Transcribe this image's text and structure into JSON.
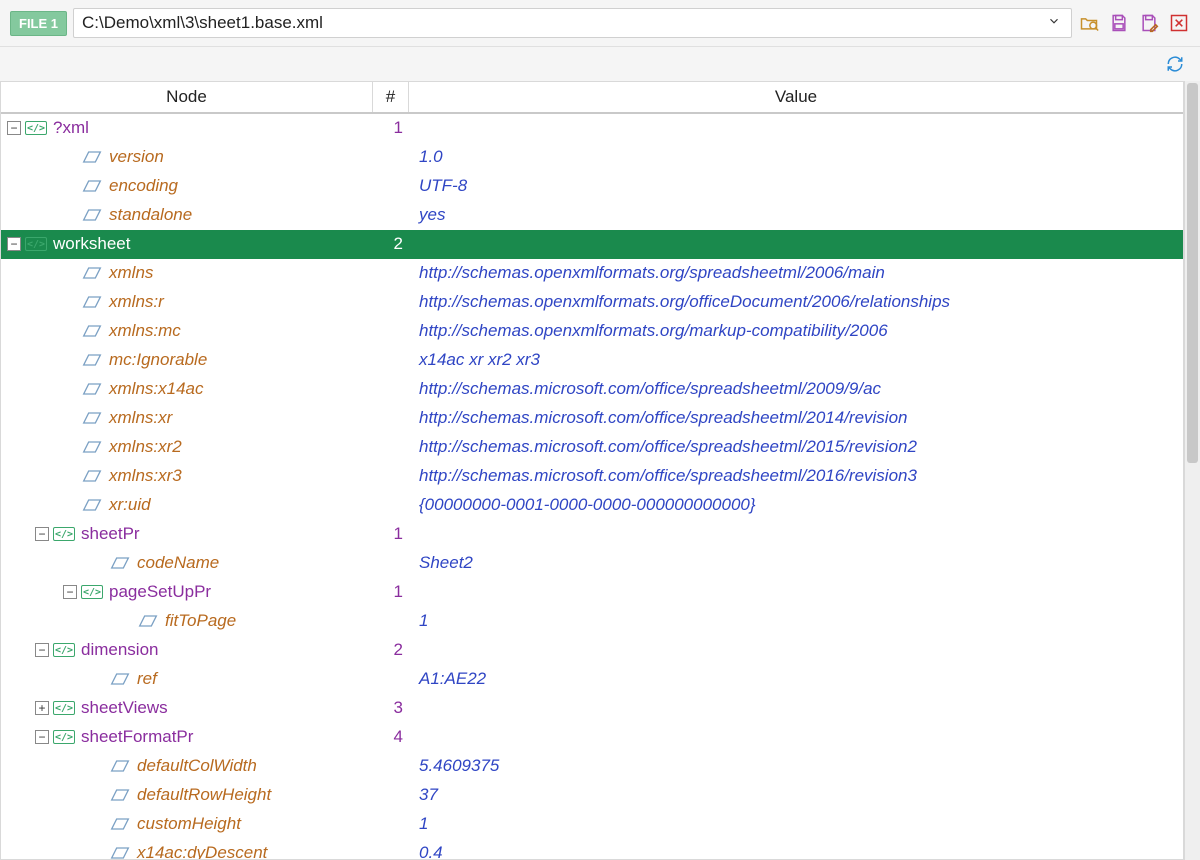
{
  "toolbar": {
    "file_badge": "FILE 1",
    "path": "C:\\Demo\\xml\\3\\sheet1.base.xml"
  },
  "headers": {
    "node": "Node",
    "num": "#",
    "value": "Value"
  },
  "rows": [
    {
      "kind": "elem",
      "depth": 0,
      "toggle": "-",
      "name": "?xml",
      "num": "1",
      "value": "",
      "selected": false
    },
    {
      "kind": "attr",
      "depth": 2,
      "toggle": "",
      "name": "version",
      "num": "",
      "value": "1.0"
    },
    {
      "kind": "attr",
      "depth": 2,
      "toggle": "",
      "name": "encoding",
      "num": "",
      "value": "UTF-8"
    },
    {
      "kind": "attr",
      "depth": 2,
      "toggle": "",
      "name": "standalone",
      "num": "",
      "value": "yes"
    },
    {
      "kind": "elem",
      "depth": 0,
      "toggle": "-",
      "name": "worksheet",
      "num": "2",
      "value": "",
      "selected": true
    },
    {
      "kind": "attr",
      "depth": 2,
      "toggle": "",
      "name": "xmlns",
      "num": "",
      "value": "http://schemas.openxmlformats.org/spreadsheetml/2006/main"
    },
    {
      "kind": "attr",
      "depth": 2,
      "toggle": "",
      "name": "xmlns:r",
      "num": "",
      "value": "http://schemas.openxmlformats.org/officeDocument/2006/relationships"
    },
    {
      "kind": "attr",
      "depth": 2,
      "toggle": "",
      "name": "xmlns:mc",
      "num": "",
      "value": "http://schemas.openxmlformats.org/markup-compatibility/2006"
    },
    {
      "kind": "attr",
      "depth": 2,
      "toggle": "",
      "name": "mc:Ignorable",
      "num": "",
      "value": "x14ac xr xr2 xr3"
    },
    {
      "kind": "attr",
      "depth": 2,
      "toggle": "",
      "name": "xmlns:x14ac",
      "num": "",
      "value": "http://schemas.microsoft.com/office/spreadsheetml/2009/9/ac"
    },
    {
      "kind": "attr",
      "depth": 2,
      "toggle": "",
      "name": "xmlns:xr",
      "num": "",
      "value": "http://schemas.microsoft.com/office/spreadsheetml/2014/revision"
    },
    {
      "kind": "attr",
      "depth": 2,
      "toggle": "",
      "name": "xmlns:xr2",
      "num": "",
      "value": "http://schemas.microsoft.com/office/spreadsheetml/2015/revision2"
    },
    {
      "kind": "attr",
      "depth": 2,
      "toggle": "",
      "name": "xmlns:xr3",
      "num": "",
      "value": "http://schemas.microsoft.com/office/spreadsheetml/2016/revision3"
    },
    {
      "kind": "attr",
      "depth": 2,
      "toggle": "",
      "name": "xr:uid",
      "num": "",
      "value": "{00000000-0001-0000-0000-000000000000}"
    },
    {
      "kind": "elem",
      "depth": 1,
      "toggle": "-",
      "name": "sheetPr",
      "num": "1",
      "value": ""
    },
    {
      "kind": "attr",
      "depth": 3,
      "toggle": "",
      "name": "codeName",
      "num": "",
      "value": "Sheet2"
    },
    {
      "kind": "elem",
      "depth": 2,
      "toggle": "-",
      "name": "pageSetUpPr",
      "num": "1",
      "value": ""
    },
    {
      "kind": "attr",
      "depth": 4,
      "toggle": "",
      "name": "fitToPage",
      "num": "",
      "value": "1"
    },
    {
      "kind": "elem",
      "depth": 1,
      "toggle": "-",
      "name": "dimension",
      "num": "2",
      "value": ""
    },
    {
      "kind": "attr",
      "depth": 3,
      "toggle": "",
      "name": "ref",
      "num": "",
      "value": "A1:AE22"
    },
    {
      "kind": "elem",
      "depth": 1,
      "toggle": "+",
      "name": "sheetViews",
      "num": "3",
      "value": ""
    },
    {
      "kind": "elem",
      "depth": 1,
      "toggle": "-",
      "name": "sheetFormatPr",
      "num": "4",
      "value": ""
    },
    {
      "kind": "attr",
      "depth": 3,
      "toggle": "",
      "name": "defaultColWidth",
      "num": "",
      "value": "5.4609375"
    },
    {
      "kind": "attr",
      "depth": 3,
      "toggle": "",
      "name": "defaultRowHeight",
      "num": "",
      "value": "37"
    },
    {
      "kind": "attr",
      "depth": 3,
      "toggle": "",
      "name": "customHeight",
      "num": "",
      "value": "1"
    },
    {
      "kind": "attr",
      "depth": 3,
      "toggle": "",
      "name": "x14ac:dyDescent",
      "num": "",
      "value": "0.4"
    }
  ]
}
